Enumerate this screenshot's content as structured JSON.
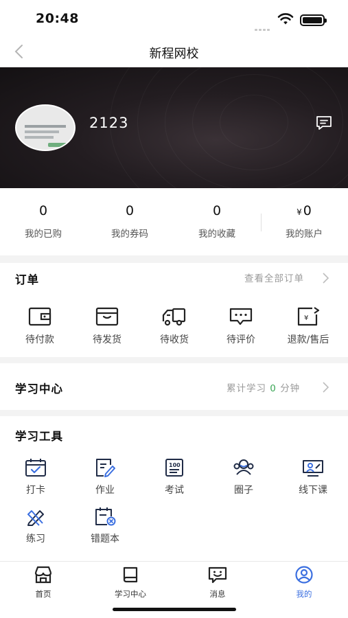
{
  "status_bar": {
    "time": "20:48"
  },
  "nav": {
    "title": "新程网校"
  },
  "profile": {
    "username": "2123"
  },
  "stats": [
    {
      "value": "0",
      "label": "我的已购"
    },
    {
      "value": "0",
      "label": "我的券码"
    },
    {
      "value": "0",
      "label": "我的收藏"
    },
    {
      "currency": "¥",
      "value": "0",
      "label": "我的账户"
    }
  ],
  "orders": {
    "title": "订单",
    "view_all": "查看全部订单",
    "items": [
      {
        "label": "待付款",
        "icon": "wallet-icon"
      },
      {
        "label": "待发货",
        "icon": "box-icon"
      },
      {
        "label": "待收货",
        "icon": "truck-icon"
      },
      {
        "label": "待评价",
        "icon": "comment-icon"
      },
      {
        "label": "退款/售后",
        "icon": "refund-icon"
      }
    ]
  },
  "learning": {
    "title": "学习中心",
    "summary_prefix": "累计学习",
    "minutes": "0",
    "summary_suffix": "分钟",
    "accent_color": "#3aa655"
  },
  "tools": {
    "title": "学习工具",
    "items": [
      {
        "label": "打卡",
        "icon": "calendar-check-icon"
      },
      {
        "label": "作业",
        "icon": "homework-icon"
      },
      {
        "label": "考试",
        "icon": "exam-icon"
      },
      {
        "label": "圈子",
        "icon": "group-icon"
      },
      {
        "label": "线下课",
        "icon": "offline-class-icon"
      },
      {
        "label": "练习",
        "icon": "practice-icon"
      },
      {
        "label": "错题本",
        "icon": "mistake-book-icon"
      }
    ]
  },
  "tabbar": {
    "active_color": "#3b6fe0",
    "tabs": [
      {
        "label": "首页",
        "icon": "home-store-icon"
      },
      {
        "label": "学习中心",
        "icon": "book-icon"
      },
      {
        "label": "消息",
        "icon": "message-icon"
      },
      {
        "label": "我的",
        "icon": "profile-icon",
        "active": true
      }
    ]
  }
}
